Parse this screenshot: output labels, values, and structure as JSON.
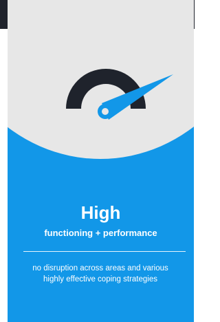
{
  "card": {
    "title": "High",
    "subtitle": "functioning + performance",
    "description": "no disruption across areas and various highly effective coping strategies"
  },
  "icons": {
    "gauge": "speedometer-gauge-icon"
  },
  "colors": {
    "accent": "#1297E8",
    "dark": "#1F232C",
    "light_panel": "#E7E7E7",
    "text": "#FFFFFF"
  }
}
